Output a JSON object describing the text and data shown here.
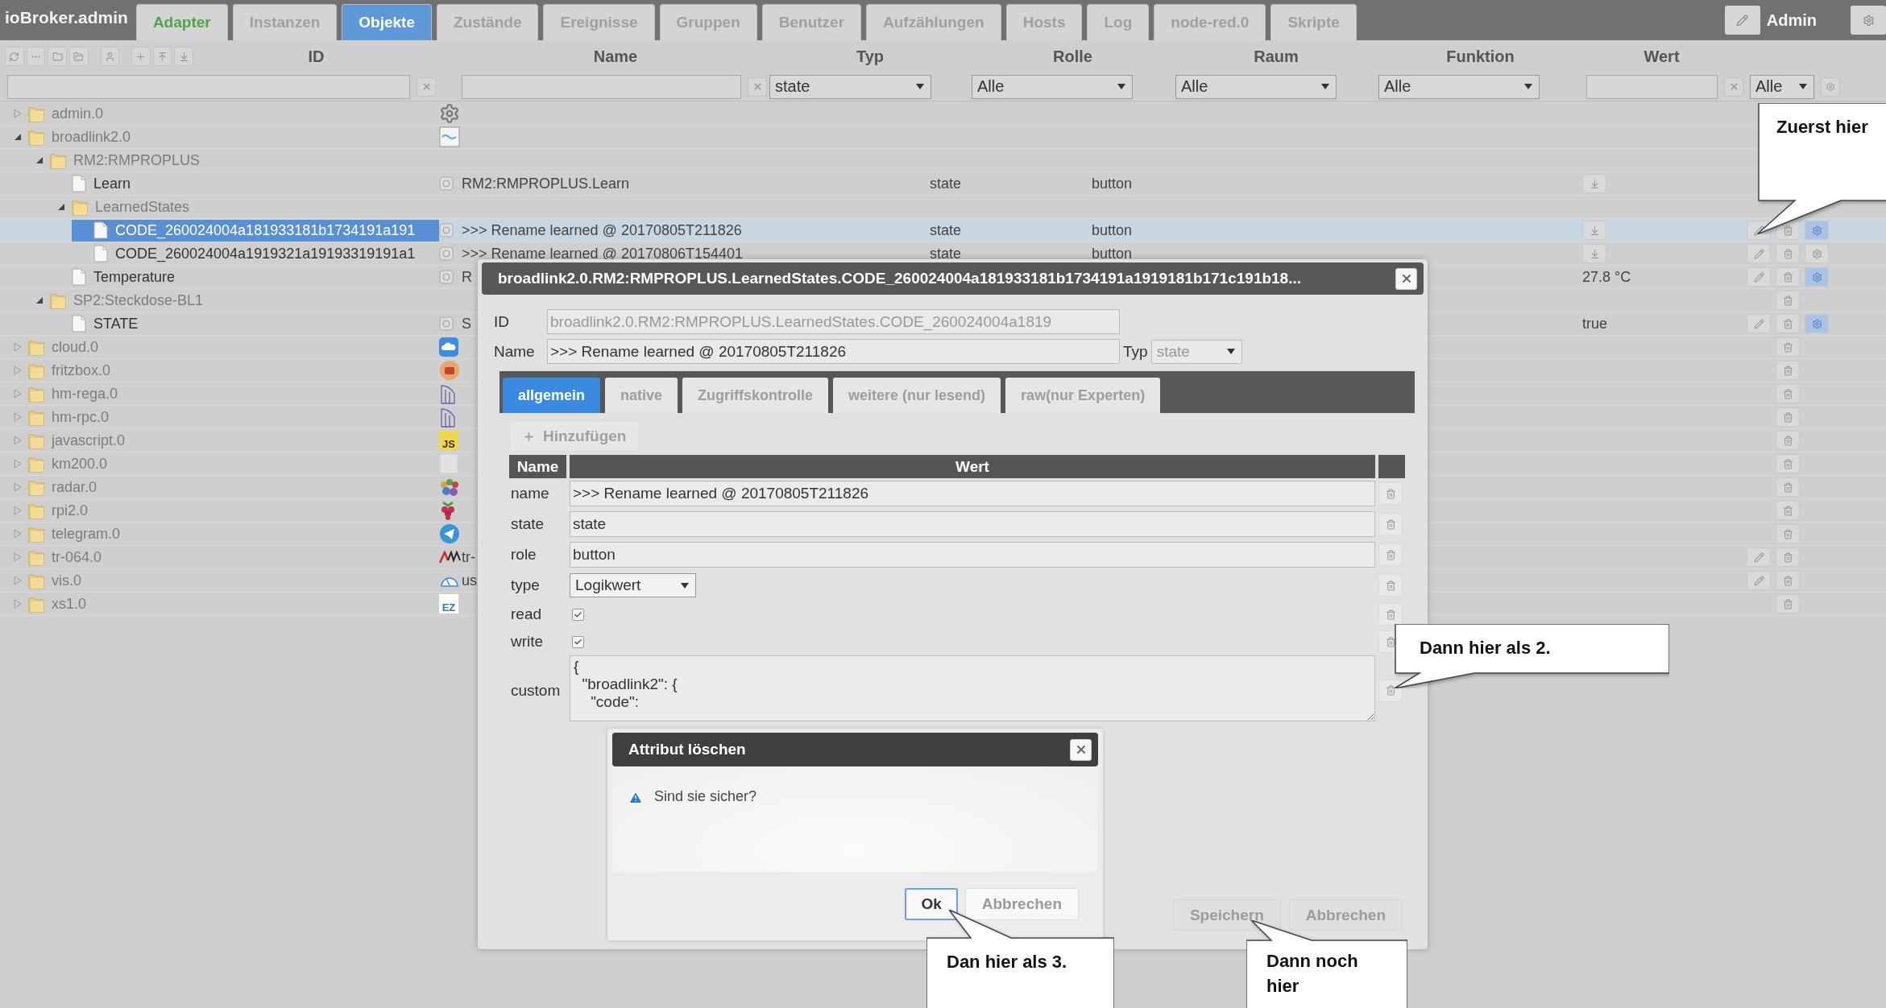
{
  "app": {
    "title": "ioBroker.admin",
    "user": "Admin"
  },
  "tabs": [
    {
      "label": "Adapter",
      "selected": false,
      "highlight": true
    },
    {
      "label": "Instanzen",
      "selected": false,
      "highlight": false
    },
    {
      "label": "Objekte",
      "selected": true,
      "highlight": false
    },
    {
      "label": "Zustände",
      "selected": false,
      "highlight": false
    },
    {
      "label": "Ereignisse",
      "selected": false,
      "highlight": false
    },
    {
      "label": "Gruppen",
      "selected": false,
      "highlight": false
    },
    {
      "label": "Benutzer",
      "selected": false,
      "highlight": false
    },
    {
      "label": "Aufzählungen",
      "selected": false,
      "highlight": false
    },
    {
      "label": "Hosts",
      "selected": false,
      "highlight": false
    },
    {
      "label": "Log",
      "selected": false,
      "highlight": false
    },
    {
      "label": "node-red.0",
      "selected": false,
      "highlight": false
    },
    {
      "label": "Skripte",
      "selected": false,
      "highlight": false
    }
  ],
  "columns": [
    "ID",
    "Name",
    "Typ",
    "Rolle",
    "Raum",
    "Funktion",
    "Wert"
  ],
  "filters": {
    "type": "state",
    "role": "Alle",
    "room": "Alle",
    "function": "Alle",
    "value": "Alle"
  },
  "tree": [
    {
      "label": "admin.0",
      "kind": "folder",
      "expanded": false,
      "selected": false
    },
    {
      "label": "broadlink2.0",
      "kind": "folder",
      "expanded": true,
      "selected": false,
      "children": [
        {
          "label": "RM2:RMPROPLUS",
          "kind": "folder",
          "expanded": true,
          "selected": false,
          "children": [
            {
              "label": "Learn",
              "kind": "state",
              "selected": false,
              "name": "RM2:RMPROPLUS.Learn",
              "type": "state",
              "role": "button",
              "buttons": [
                {
                  "kind": "download"
                }
              ]
            },
            {
              "label": "LearnedStates",
              "kind": "folder",
              "expanded": true,
              "selected": false,
              "children": [
                {
                  "label": "CODE_260024004a181933181b1734191a191",
                  "kind": "state",
                  "selected": true,
                  "name": ">>> Rename learned @ 20170805T211826",
                  "type": "state",
                  "role": "button",
                  "buttons": [
                    {
                      "kind": "download"
                    },
                    {
                      "kind": "edit"
                    },
                    {
                      "kind": "delete"
                    },
                    {
                      "kind": "settings",
                      "active": true
                    }
                  ]
                },
                {
                  "label": "CODE_260024004a1919321a19193319191a1",
                  "kind": "state",
                  "selected": false,
                  "name": ">>> Rename learned @ 20170806T154401",
                  "type": "state",
                  "role": "button",
                  "buttons": [
                    {
                      "kind": "download"
                    },
                    {
                      "kind": "edit"
                    },
                    {
                      "kind": "delete"
                    },
                    {
                      "kind": "settings",
                      "active": false
                    }
                  ]
                }
              ]
            },
            {
              "label": "Temperature",
              "kind": "state",
              "selected": false,
              "name": "R",
              "value": "27.8 °C",
              "buttons": [
                {
                  "kind": "edit"
                },
                {
                  "kind": "delete"
                },
                {
                  "kind": "settings",
                  "active": true
                }
              ]
            }
          ]
        },
        {
          "label": "SP2:Steckdose-BL1",
          "kind": "folder",
          "expanded": true,
          "selected": false,
          "buttons": [
            {
              "kind": "delete"
            }
          ],
          "children": [
            {
              "label": "STATE",
              "kind": "state",
              "selected": false,
              "name": "S",
              "value": "true",
              "buttons": [
                {
                  "kind": "edit"
                },
                {
                  "kind": "delete"
                },
                {
                  "kind": "settings",
                  "active": true
                }
              ]
            }
          ]
        }
      ]
    },
    {
      "label": "cloud.0",
      "kind": "folder",
      "expanded": false,
      "selected": false,
      "buttons": [
        {
          "kind": "delete"
        }
      ]
    },
    {
      "label": "fritzbox.0",
      "kind": "folder",
      "expanded": false,
      "selected": false,
      "buttons": [
        {
          "kind": "delete"
        }
      ]
    },
    {
      "label": "hm-rega.0",
      "kind": "folder",
      "expanded": false,
      "selected": false,
      "buttons": [
        {
          "kind": "delete"
        }
      ]
    },
    {
      "label": "hm-rpc.0",
      "kind": "folder",
      "expanded": false,
      "selected": false,
      "buttons": [
        {
          "kind": "delete"
        }
      ]
    },
    {
      "label": "javascript.0",
      "kind": "folder",
      "expanded": false,
      "selected": false,
      "icon_label": "JS",
      "buttons": [
        {
          "kind": "delete"
        }
      ]
    },
    {
      "label": "km200.0",
      "kind": "folder",
      "expanded": false,
      "selected": false,
      "buttons": [
        {
          "kind": "delete"
        }
      ]
    },
    {
      "label": "radar.0",
      "kind": "folder",
      "expanded": false,
      "selected": false,
      "buttons": [
        {
          "kind": "delete"
        }
      ]
    },
    {
      "label": "rpi2.0",
      "kind": "folder",
      "expanded": false,
      "selected": false,
      "buttons": [
        {
          "kind": "delete"
        }
      ]
    },
    {
      "label": "telegram.0",
      "kind": "folder",
      "expanded": false,
      "selected": false,
      "buttons": [
        {
          "kind": "delete"
        }
      ]
    },
    {
      "label": "tr-064.0",
      "kind": "folder",
      "expanded": false,
      "selected": false,
      "name": "tr-",
      "buttons": [
        {
          "kind": "edit"
        },
        {
          "kind": "delete"
        }
      ]
    },
    {
      "label": "vis.0",
      "kind": "folder",
      "expanded": false,
      "selected": false,
      "name": "us",
      "buttons": [
        {
          "kind": "edit"
        },
        {
          "kind": "delete"
        }
      ]
    },
    {
      "label": "xs1.0",
      "kind": "folder",
      "expanded": false,
      "selected": false,
      "icon_label": "EZ",
      "buttons": [
        {
          "kind": "delete"
        }
      ]
    }
  ],
  "dialog": {
    "title": "broadlink2.0.RM2:RMPROPLUS.LearnedStates.CODE_260024004a181933181b1734191a1919181b171c191b18...",
    "id_label": "ID",
    "id_value": "broadlink2.0.RM2:RMPROPLUS.LearnedStates.CODE_260024004a1819",
    "name_label": "Name",
    "name_value": ">>> Rename learned @ 20170805T211826",
    "type_label": "Typ",
    "type_value": "state",
    "tabs": [
      {
        "label": "allgemein",
        "selected": true
      },
      {
        "label": "native",
        "selected": false
      },
      {
        "label": "Zugriffskontrolle",
        "selected": false
      },
      {
        "label": "weitere (nur lesend)",
        "selected": false
      },
      {
        "label": "raw(nur Experten)",
        "selected": false
      }
    ],
    "add_button": "Hinzufügen",
    "columns": [
      "Name",
      "Wert"
    ],
    "rows": [
      {
        "kind": "text",
        "name": "name",
        "value": ">>> Rename learned @ 20170805T211826"
      },
      {
        "kind": "text",
        "name": "state",
        "value": "state"
      },
      {
        "kind": "text",
        "name": "role",
        "value": "button"
      },
      {
        "kind": "select",
        "name": "type",
        "value": "Logikwert"
      },
      {
        "kind": "checkbox",
        "name": "read",
        "checked": true
      },
      {
        "kind": "checkbox",
        "name": "write",
        "checked": true
      },
      {
        "kind": "textarea",
        "name": "custom",
        "value": "{\n  \"broadlink2\": {\n    \"code\":"
      }
    ],
    "buttons": [
      "Speichern",
      "Abbrechen"
    ]
  },
  "confirm": {
    "title": "Attribut löschen",
    "message": "Sind sie sicher?",
    "buttons": [
      {
        "label": "Ok",
        "focused": true
      },
      {
        "label": "Abbrechen",
        "focused": false
      }
    ]
  },
  "callouts": [
    "Zuerst hier",
    "Dann hier als 2.",
    "Dan hier als 3.",
    "Dann noch hier"
  ]
}
